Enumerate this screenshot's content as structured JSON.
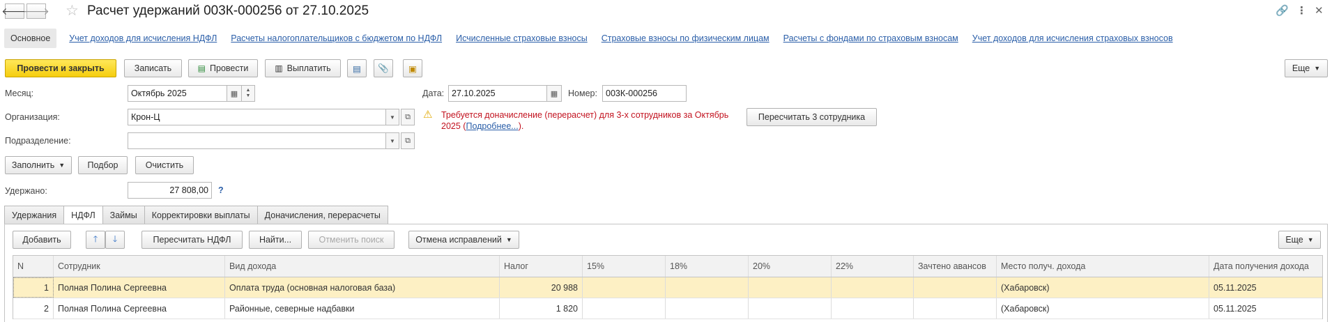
{
  "title": "Расчет удержаний 003К-000256 от 27.10.2025",
  "section_nav": {
    "current": "Основное",
    "links": [
      "Учет доходов для исчисления НДФЛ",
      "Расчеты налогоплательщиков с бюджетом по НДФЛ",
      "Исчисленные страховые взносы",
      "Страховые взносы по физическим лицам",
      "Расчеты с фондами по страховым взносам",
      "Учет доходов для исчисления страховых взносов"
    ]
  },
  "toolbar": {
    "post_close": "Провести и закрыть",
    "save": "Записать",
    "post": "Провести",
    "pay": "Выплатить",
    "more": "Еще"
  },
  "form": {
    "month_label": "Месяц:",
    "month_value": "Октябрь 2025",
    "date_label": "Дата:",
    "date_value": "27.10.2025",
    "number_label": "Номер:",
    "number_value": "003К-000256",
    "org_label": "Организация:",
    "org_value": "Крон-Ц",
    "dept_label": "Подразделение:",
    "dept_value": "",
    "warning_text": "Требуется доначисление (перерасчет) для 3-х сотрудников за Октябрь 2025 (",
    "warning_link": "Подробнее...",
    "warning_tail": ").",
    "recalc_btn": "Пересчитать 3 сотрудника",
    "fill_btn": "Заполнить",
    "select_btn": "Подбор",
    "clear_btn": "Очистить",
    "withheld_label": "Удержано:",
    "withheld_value": "27 808,00",
    "help": "?"
  },
  "tabs": [
    "Удержания",
    "НДФЛ",
    "Займы",
    "Корректировки выплаты",
    "Доначисления, перерасчеты"
  ],
  "table_toolbar": {
    "add": "Добавить",
    "recalc_ndfl": "Пересчитать НДФЛ",
    "find": "Найти...",
    "cancel_search": "Отменить поиск",
    "undo_fix": "Отмена исправлений",
    "more": "Еще"
  },
  "table": {
    "columns": [
      "N",
      "Сотрудник",
      "Вид дохода",
      "Налог",
      "15%",
      "18%",
      "20%",
      "22%",
      "Зачтено авансов",
      "Место получ. дохода",
      "Дата получения дохода"
    ],
    "rows": [
      [
        "1",
        "Полная Полина Сергеевна",
        "Оплата труда (основная налоговая база)",
        "20 988",
        "",
        "",
        "",
        "",
        "",
        "(Хабаровск)",
        "05.11.2025"
      ],
      [
        "2",
        "Полная Полина Сергеевна",
        "Районные, северные надбавки",
        "1 820",
        "",
        "",
        "",
        "",
        "",
        "(Хабаровск)",
        "05.11.2025"
      ]
    ]
  },
  "colors": {
    "primary_button": "#f5cd0e",
    "warning_text": "#c2121f",
    "link": "#2a5ea8",
    "selected_row": "#fdf0c4"
  }
}
